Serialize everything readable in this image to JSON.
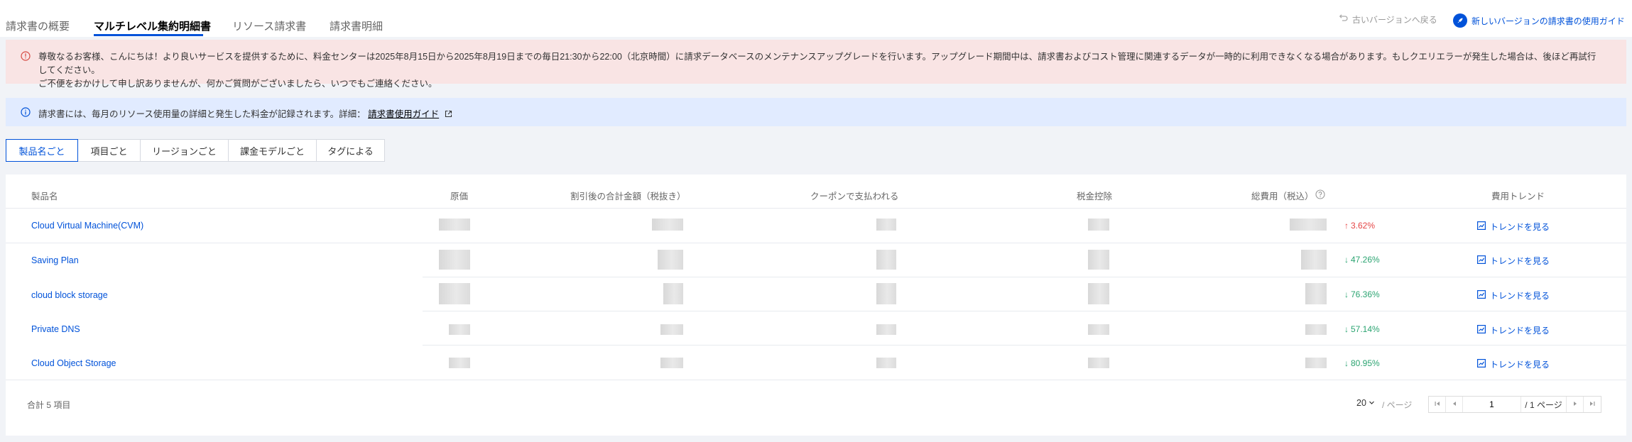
{
  "tabs": [
    {
      "label": "請求書の概要"
    },
    {
      "label": "マルチレベル集約明細書"
    },
    {
      "label": "リソース請求書"
    },
    {
      "label": "請求書明細"
    }
  ],
  "top_links": {
    "old_version": "古いバージョンへ戻る",
    "new_guide": "新しいバージョンの請求書の使用ガイド"
  },
  "alert_maintenance": {
    "line1": "尊敬なるお客様、こんにちは！より良いサービスを提供するために、料金センターは2025年8月15日から2025年8月19日までの毎日21:30から22:00（北京時間）に請求データベースのメンテナンスアップグレードを行います。アップグレード期間中は、請求書およびコスト管理に関連するデータが一時的に利用できなくなる場合があります。もしクエリエラーが発生した場合は、後ほど再試行してください。",
    "line2": "ご不便をおかけして申し訳ありませんが、何かご質問がございましたら、いつでもご連絡ください。"
  },
  "alert_info": {
    "text": "請求書には、毎月のリソース使用量の詳細と発生した料金が記録されます。詳細：",
    "link": "請求書使用ガイド"
  },
  "segments": [
    {
      "label": "製品名ごと"
    },
    {
      "label": "項目ごと"
    },
    {
      "label": "リージョンごと"
    },
    {
      "label": "課金モデルごと"
    },
    {
      "label": "タグによる"
    }
  ],
  "table": {
    "columns": {
      "product": "製品名",
      "original": "原価",
      "discounted": "割引後の合計金額（税抜き）",
      "coupon": "クーポンで支払われる",
      "tax": "税金控除",
      "total": "総費用（税込）",
      "trend": "費用トレンド"
    },
    "rows": [
      {
        "product": "Cloud Virtual Machine(CVM)",
        "direction": "up",
        "arrow": "↑",
        "change": "3.62%",
        "action": "トレンドを見る"
      },
      {
        "product": "Saving Plan",
        "direction": "down",
        "arrow": "↓",
        "change": "47.26%",
        "action": "トレンドを見る"
      },
      {
        "product": "cloud block storage",
        "direction": "down",
        "arrow": "↓",
        "change": "76.36%",
        "action": "トレンドを見る"
      },
      {
        "product": "Private DNS",
        "direction": "down",
        "arrow": "↓",
        "change": "57.14%",
        "action": "トレンドを見る"
      },
      {
        "product": "Cloud Object Storage",
        "direction": "down",
        "arrow": "↓",
        "change": "80.95%",
        "action": "トレンドを見る"
      }
    ]
  },
  "footer": {
    "total": "合計 5 項目",
    "page_size": "20",
    "per_page": "/ ページ",
    "current_page": "1",
    "total_pages": "/ 1 ページ"
  },
  "colors": {
    "primary": "#0052d9",
    "up": "#e54545",
    "down": "#2ba471",
    "alert_error_bg": "#f9e4e4",
    "alert_info_bg": "#e1ebff"
  }
}
